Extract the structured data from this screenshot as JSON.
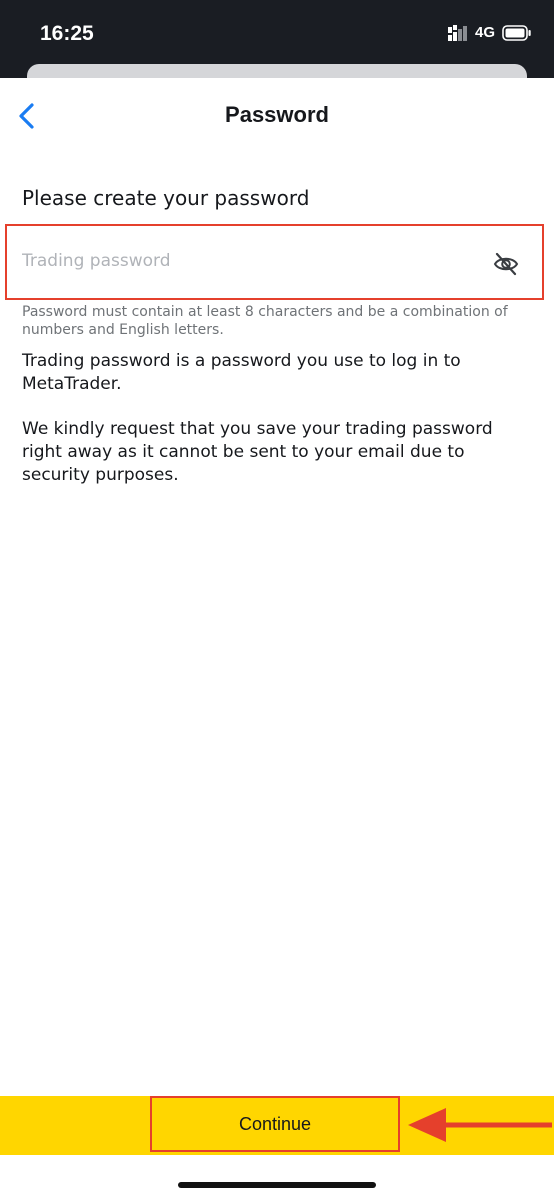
{
  "status_bar": {
    "time": "16:25",
    "network": "4G"
  },
  "nav": {
    "title": "Password"
  },
  "form": {
    "heading": "Please create your password",
    "password_placeholder": "Trading password",
    "password_value": "",
    "hint": "Password must contain at least 8 characters and be a combination of numbers and English letters."
  },
  "info": {
    "paragraph1": "Trading password is a password you use to log in to MetaTrader.",
    "paragraph2": "We kindly request that you save your trading password right away as it cannot be sent to your email due to security purposes."
  },
  "footer": {
    "continue_label": "Continue"
  },
  "colors": {
    "accent": "#ffd600",
    "highlight_outline": "#e5402c",
    "link_blue": "#1a7cf2",
    "status_bar_bg": "#1a1d23"
  },
  "icons": {
    "back": "chevron-left-icon",
    "visibility": "eye-off-icon",
    "signal": "signal-bars-icon",
    "battery": "battery-icon",
    "pointer": "arrow-left-icon"
  }
}
